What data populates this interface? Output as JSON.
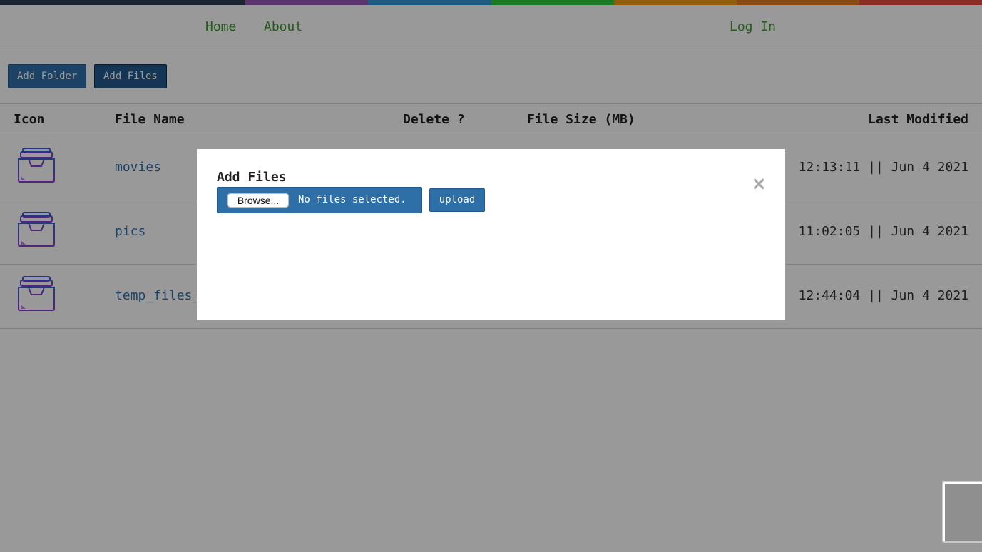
{
  "colors": {
    "rainbow": [
      "#2c3e50",
      "#2c3e50",
      "#9b59b6",
      "#3498db",
      "#2ecc40",
      "#f39c12",
      "#e67e22",
      "#e74c3c"
    ],
    "link": "#3c9a2c",
    "primary": "#2f6fa8",
    "folder_icon_top": "#3b5bd6",
    "folder_icon_bottom": "#8e3bd0"
  },
  "nav": {
    "home": "Home",
    "about": "About",
    "login": "Log In"
  },
  "toolbar": {
    "add_folder": "Add Folder",
    "add_files": "Add Files"
  },
  "table": {
    "headers": {
      "icon": "Icon",
      "file_name": "File Name",
      "delete": "Delete ?",
      "file_size": "File Size (MB)",
      "last_modified": "Last Modified"
    },
    "rows": [
      {
        "icon": "folder-tray-icon",
        "name": "movies",
        "modified": "12:13:11 || Jun 4 2021"
      },
      {
        "icon": "folder-tray-icon",
        "name": "pics",
        "modified": "11:02:05 || Jun 4 2021"
      },
      {
        "icon": "folder-tray-icon",
        "name": "temp_files_",
        "modified": "12:44:04 || Jun 4 2021"
      }
    ]
  },
  "modal": {
    "title": "Add Files",
    "close_icon": "close-icon",
    "browse": "Browse...",
    "file_status": "No files selected.",
    "upload": "upload"
  }
}
